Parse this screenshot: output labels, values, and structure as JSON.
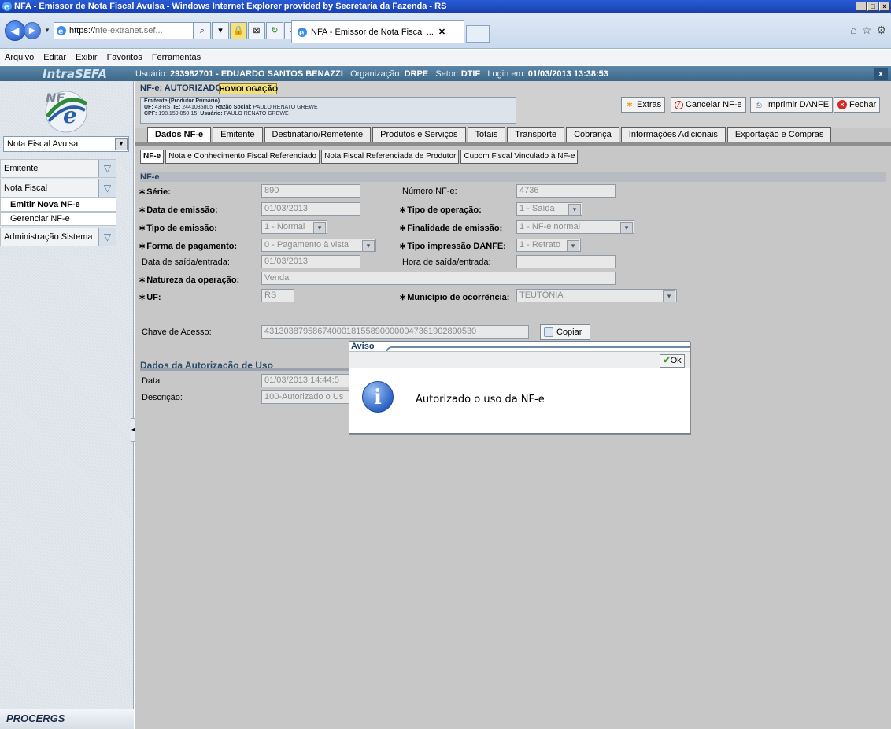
{
  "window": {
    "title": "NFA - Emissor de Nota Fiscal Avulsa - Windows Internet Explorer provided by Secretaria da Fazenda - RS"
  },
  "browser": {
    "url_scheme": "https://",
    "url_host": "nfe-extranet.sef...",
    "tab_title": "NFA - Emissor de Nota Fiscal ...",
    "menu": [
      "Arquivo",
      "Editar",
      "Exibir",
      "Favoritos",
      "Ferramentas"
    ]
  },
  "app_header": {
    "brand": "IntraSEFA",
    "user_label": "Usuário:",
    "user_value": "293982701 - EDUARDO SANTOS BENAZZI",
    "org_label": "Organização:",
    "org_value": "DRPE",
    "setor_label": "Setor:",
    "setor_value": "DTIF",
    "login_label": "Login em:",
    "login_value": "01/03/2013 13:38:53",
    "close_label": "x"
  },
  "sidebar": {
    "select_value": "Nota Fiscal Avulsa",
    "groups": [
      {
        "label": "Emitente"
      },
      {
        "label": "Nota Fiscal"
      },
      {
        "label": "Administração Sistema"
      }
    ],
    "items": [
      {
        "label": "Emitir Nova NF-e"
      },
      {
        "label": "Gerenciar NF-e"
      }
    ],
    "footer": "PROCERGS"
  },
  "nfe": {
    "status": "NF-e: AUTORIZADO USO",
    "environment": "HOMOLOGAÇÃO",
    "emitente_legend": "Emitente (Produtor Primário)",
    "uf_label": "UF:",
    "uf_value": "43-RS",
    "ie_label": "IE:",
    "ie_value": "2441035805",
    "razao_label": "Razão Social:",
    "razao_value": "PAULO RENATO GREWE",
    "cpf_label": "CPF:",
    "cpf_value": "198.159.050-15",
    "usuario_label": "Usuário:",
    "usuario_value": "PAULO RENATO GREWE"
  },
  "actions": {
    "extras": "Extras",
    "cancelar": "Cancelar NF-e",
    "imprimir": "Imprimir DANFE",
    "fechar": "Fechar"
  },
  "tabs_main": [
    "Dados NF-e",
    "Emitente",
    "Destinatário/Remetente",
    "Produtos e Serviços",
    "Totais",
    "Transporte",
    "Cobrança",
    "Informações Adicionais",
    "Exportação e Compras"
  ],
  "tabs_sub": [
    "NF-e",
    "Nota e Conhecimento Fiscal Referenciado",
    "Nota Fiscal Referenciada de Produtor",
    "Cupom Fiscal Vinculado à NF-e"
  ],
  "form": {
    "section": "NF-e",
    "serie_label": "Série:",
    "serie_value": "890",
    "numero_label": "Número NF-e:",
    "numero_value": "4736",
    "data_emissao_label": "Data de emissão:",
    "data_emissao_value": "01/03/2013",
    "tipo_operacao_label": "Tipo de operação:",
    "tipo_operacao_value": "1 - Saída",
    "tipo_emissao_label": "Tipo de emissão:",
    "tipo_emissao_value": "1 - Normal",
    "finalidade_label": "Finalidade de emissão:",
    "finalidade_value": "1 - NF-e normal",
    "forma_pagamento_label": "Forma de pagamento:",
    "forma_pagamento_value": "0 - Pagamento à vista",
    "tipo_impressao_label": "Tipo impressão DANFE:",
    "tipo_impressao_value": "1 - Retrato",
    "data_saida_label": "Data de saída/entrada:",
    "data_saida_value": "01/03/2013",
    "hora_saida_label": "Hora de saída/entrada:",
    "hora_saida_value": "",
    "natureza_label": "Natureza da operação:",
    "natureza_value": "Venda",
    "uf_label": "UF:",
    "uf_value": "RS",
    "municipio_label": "Município de ocorrência:",
    "municipio_value": "TEUTÔNIA",
    "chave_label": "Chave de Acesso:",
    "chave_value": "43130387958674000181558900000047361902890530",
    "copiar": "Copiar"
  },
  "autorizacao": {
    "section": "Dados da Autorização de Uso",
    "data_label": "Data:",
    "data_value": "01/03/2013 14:44:5",
    "descricao_label": "Descrição:",
    "descricao_value": "100-Autorizado o Us"
  },
  "dialog": {
    "title": "Aviso",
    "ok": "Ok",
    "message": "Autorizado o uso da NF-e"
  }
}
